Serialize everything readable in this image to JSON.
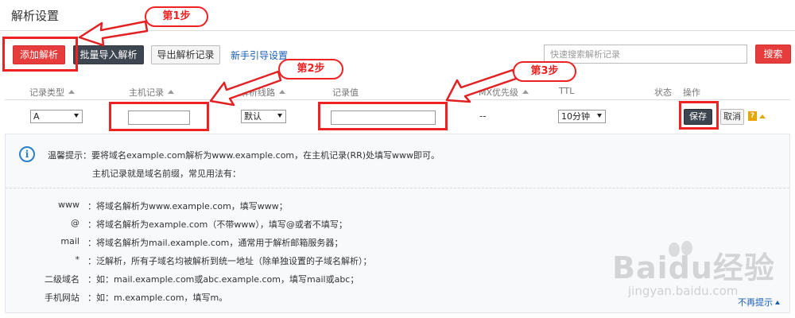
{
  "page": {
    "title": "解析设置"
  },
  "toolbar": {
    "add_label": "添加解析",
    "batch_import_label": "批量导入解析",
    "export_label": "导出解析记录",
    "guide_label": "新手引导设置",
    "search_placeholder": "快速搜索解析记录",
    "search_label": "搜索"
  },
  "table": {
    "headers": [
      "记录类型",
      "主机记录",
      "解析线路",
      "记录值",
      "MX优先级",
      "TTL",
      "状态",
      "操作"
    ],
    "row": {
      "type": "A",
      "host": "",
      "line": "默认",
      "value": "",
      "mx": "--",
      "ttl": "10分钟",
      "save_label": "保存",
      "cancel_label": "取消",
      "help_label": "?"
    }
  },
  "annotations": {
    "step1": "第1步",
    "step2": "第2步",
    "step3": "第3步",
    "color": "#e22222"
  },
  "tips": {
    "line1": "温馨提示：要将域名example.com解析为www.example.com，在主机记录(RR)处填写www即可。",
    "line2": "主机记录就是域名前缀，常见用法有：",
    "examples": [
      {
        "key": "www",
        "desc": "：将域名解析为www.example.com，填写www；"
      },
      {
        "key": "@",
        "desc": "：将域名解析为example.com（不带www），填写@或者不填写；"
      },
      {
        "key": "mail",
        "desc": "：将域名解析为mail.example.com，通常用于解析邮箱服务器；"
      },
      {
        "key": "*",
        "desc": "：泛解析，所有子域名均被解析到统一地址（除单独设置的子域名解析）；"
      },
      {
        "key": "二级域名",
        "desc": "：如：mail.example.com或abc.example.com，填写mail或abc；"
      },
      {
        "key": "手机网站",
        "desc": "：如：m.example.com，填写m。"
      }
    ],
    "no_show_label": "不再提示"
  },
  "watermark": {
    "brand": "Baidu经验",
    "url": "jingyan.baidu.com"
  }
}
